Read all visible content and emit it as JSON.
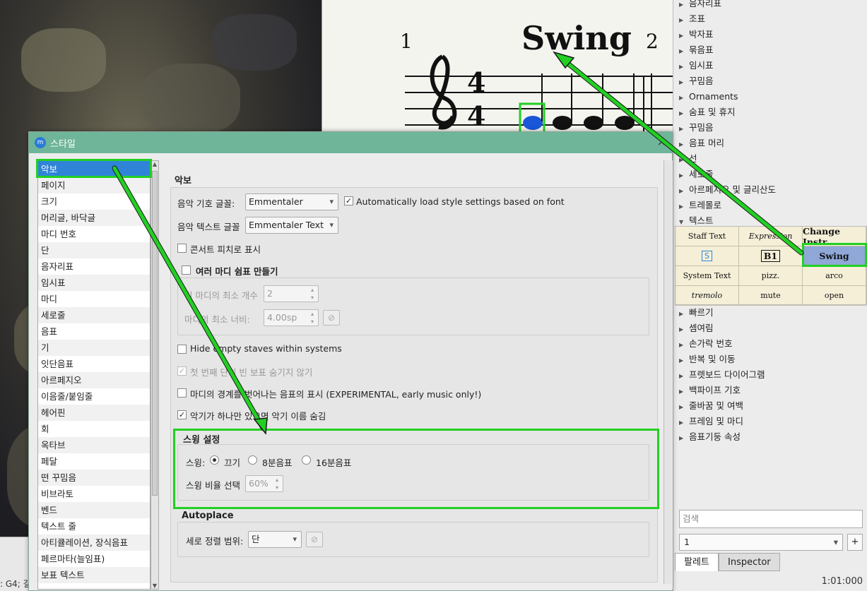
{
  "score": {
    "measure1": "1",
    "measure2": "2",
    "swing_text": "Swing",
    "time_sig_top": "4",
    "time_sig_bottom": "4"
  },
  "status_left": ": G4; 길",
  "palette": {
    "items": [
      {
        "label": "음자리표",
        "expanded": false
      },
      {
        "label": "조표",
        "expanded": false
      },
      {
        "label": "박자표",
        "expanded": false
      },
      {
        "label": "묶음표",
        "expanded": false
      },
      {
        "label": "임시표",
        "expanded": false
      },
      {
        "label": "꾸밈음",
        "expanded": false
      },
      {
        "label": "Ornaments",
        "expanded": false
      },
      {
        "label": "숨표 및 휴지",
        "expanded": false
      },
      {
        "label": "꾸밈음",
        "expanded": false
      },
      {
        "label": "음표 머리",
        "expanded": false
      },
      {
        "label": "선",
        "expanded": false
      },
      {
        "label": "세로줄",
        "expanded": false
      },
      {
        "label": "아르페지오 및 글리산도",
        "expanded": false
      },
      {
        "label": "트레몰로",
        "expanded": false
      },
      {
        "label": "텍스트",
        "expanded": true
      }
    ],
    "text_cells": [
      "Staff Text",
      "Expression",
      "Change Instr.",
      "S",
      "B1",
      "Swing",
      "System Text",
      "pizz.",
      "arco",
      "tremolo",
      "mute",
      "open"
    ],
    "items_after": [
      {
        "label": "빠르기"
      },
      {
        "label": "셈여림"
      },
      {
        "label": "손가락 번호"
      },
      {
        "label": "반복 및 이동"
      },
      {
        "label": "프렛보드 다이어그램"
      },
      {
        "label": "백파이프 기호"
      },
      {
        "label": "줄바꿈 및 여백"
      },
      {
        "label": "프레임 및 마디"
      },
      {
        "label": "음표기둥 속성"
      }
    ],
    "search_placeholder": "검색",
    "workspace": "1",
    "plus": "+",
    "tabs": [
      "팔레트",
      "Inspector"
    ]
  },
  "status_right": "1:01:000",
  "dialog": {
    "title": "스타일",
    "close": "×",
    "nav": [
      "악보",
      "페이지",
      "크기",
      "머리글, 바닥글",
      "마디 번호",
      "단",
      "음자리표",
      "임시표",
      "마디",
      "세로줄",
      "음표",
      "기",
      "잇단음표",
      "아르페지오",
      "이음줄/붙임줄",
      "헤어핀",
      "회",
      "옥타브",
      "페달",
      "떤 꾸밈음",
      "비브라토",
      "벤드",
      "텍스트 줄",
      "아티큘레이션, 장식음표",
      "페르마타(늘임표)",
      "보표 텍스트"
    ],
    "selected_nav": "악보",
    "section_title": "악보",
    "music_font_label": "음악 기호 글꼴:",
    "music_font": "Emmentaler",
    "auto_load_label": "Automatically load style settings based on font",
    "auto_load_checked": true,
    "text_font_label": "음악 텍스트 글꼴",
    "text_font": "Emmentaler Text",
    "concert_pitch_label": "콘서트 피치로 표시",
    "concert_pitch_checked": false,
    "multi_rest_label": "여러 마디 쉼표 만들기",
    "multi_rest_checked": false,
    "min_empty_label": "빈 마디의 최소 개수",
    "min_empty_value": "2",
    "min_width_label": "마디의 최소 너비:",
    "min_width_value": "4.00sp",
    "hide_empty_label": "Hide empty staves within systems",
    "hide_empty_checked": false,
    "dont_hide_first_label": "첫 번째 단의 빈 보표 숨기지 않기",
    "dont_hide_first_checked": true,
    "cross_measure_label": "마디의 경계를 벗어나는 음표의 표시 (EXPERIMENTAL, early music only!)",
    "cross_measure_checked": false,
    "hide_instr_label": "악기가 하나만 있으면 악기 이름 숨김",
    "hide_instr_checked": true,
    "swing_section": "스윙 설정",
    "swing_label": "스윙:",
    "swing_options": [
      "끄기",
      "8분음표",
      "16분음표"
    ],
    "swing_selected": "끄기",
    "swing_ratio_label": "스윙 비율 선택",
    "swing_ratio_value": "60%",
    "autoplace_section": "Autoplace",
    "vertical_align_label": "세로 정렬 범위:",
    "vertical_align_value": "단"
  },
  "colors": {
    "titlebar": "#6fb59a",
    "selection": "#2f84d8",
    "highlight": "#22d022",
    "swing_cell": "#8fa8d8"
  }
}
